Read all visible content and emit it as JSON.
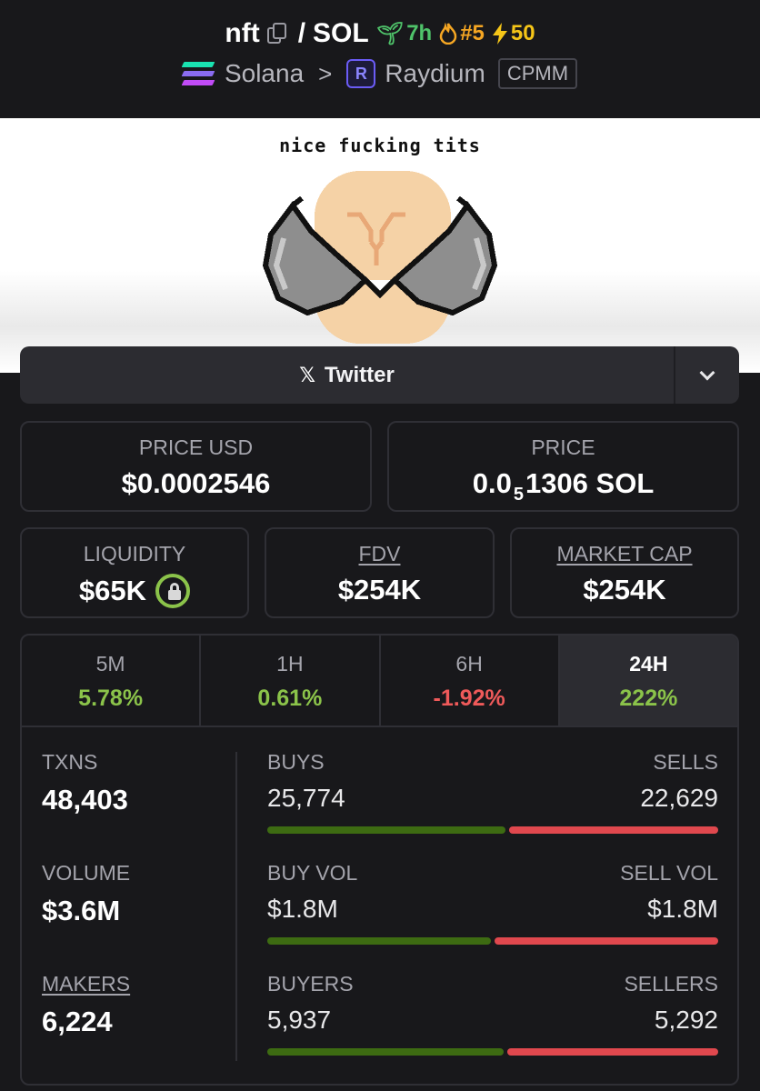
{
  "header": {
    "token": "nft",
    "pair_sep": "/",
    "quote": "SOL",
    "age": "7h",
    "trend_rank": "#5",
    "boosts": "50",
    "chain": "Solana",
    "dex": "Raydium",
    "pool_type": "CPMM"
  },
  "banner": {
    "caption": "nice fucking tits"
  },
  "twitter": {
    "label": "Twitter"
  },
  "price": {
    "usd_label": "PRICE USD",
    "usd_value": "$0.0002546",
    "native_label": "PRICE",
    "native_prefix": "0.0",
    "native_zeros": "5",
    "native_suffix": "1306 SOL"
  },
  "stats": {
    "liquidity_label": "LIQUIDITY",
    "liquidity_value": "$65K",
    "fdv_label": "FDV",
    "fdv_value": "$254K",
    "mcap_label": "MARKET CAP",
    "mcap_value": "$254K"
  },
  "timeframes": [
    {
      "label": "5M",
      "value": "5.78%"
    },
    {
      "label": "1H",
      "value": "0.61%"
    },
    {
      "label": "6H",
      "value": "-1.92%"
    },
    {
      "label": "24H",
      "value": "222%"
    }
  ],
  "metrics": {
    "txns_label": "TXNS",
    "txns_value": "48,403",
    "volume_label": "VOLUME",
    "volume_value": "$3.6M",
    "makers_label": "MAKERS",
    "makers_value": "6,224"
  },
  "splits": {
    "buys_label": "BUYS",
    "buys_value": "25,774",
    "sells_label": "SELLS",
    "sells_value": "22,629",
    "buy_vol_label": "BUY VOL",
    "buy_vol_value": "$1.8M",
    "sell_vol_label": "SELL VOL",
    "sell_vol_value": "$1.8M",
    "buyers_label": "BUYERS",
    "buyers_value": "5,937",
    "sellers_label": "SELLERS",
    "sellers_value": "5,292",
    "buys_ratio": 0.532,
    "buy_vol_ratio": 0.5,
    "buyers_ratio": 0.529
  },
  "colors": {
    "positive": "#8bc34a",
    "negative": "#ef5a5a",
    "buy_bar": "#3d6b12",
    "sell_bar": "#e0484e"
  },
  "icons": {
    "copy": "copy-icon",
    "age": "sprout-icon",
    "trend": "fire-icon",
    "boost": "lightning-icon",
    "chain": "solana-logo",
    "dex": "raydium-logo",
    "social": "x-icon",
    "lock": "lock-icon"
  }
}
